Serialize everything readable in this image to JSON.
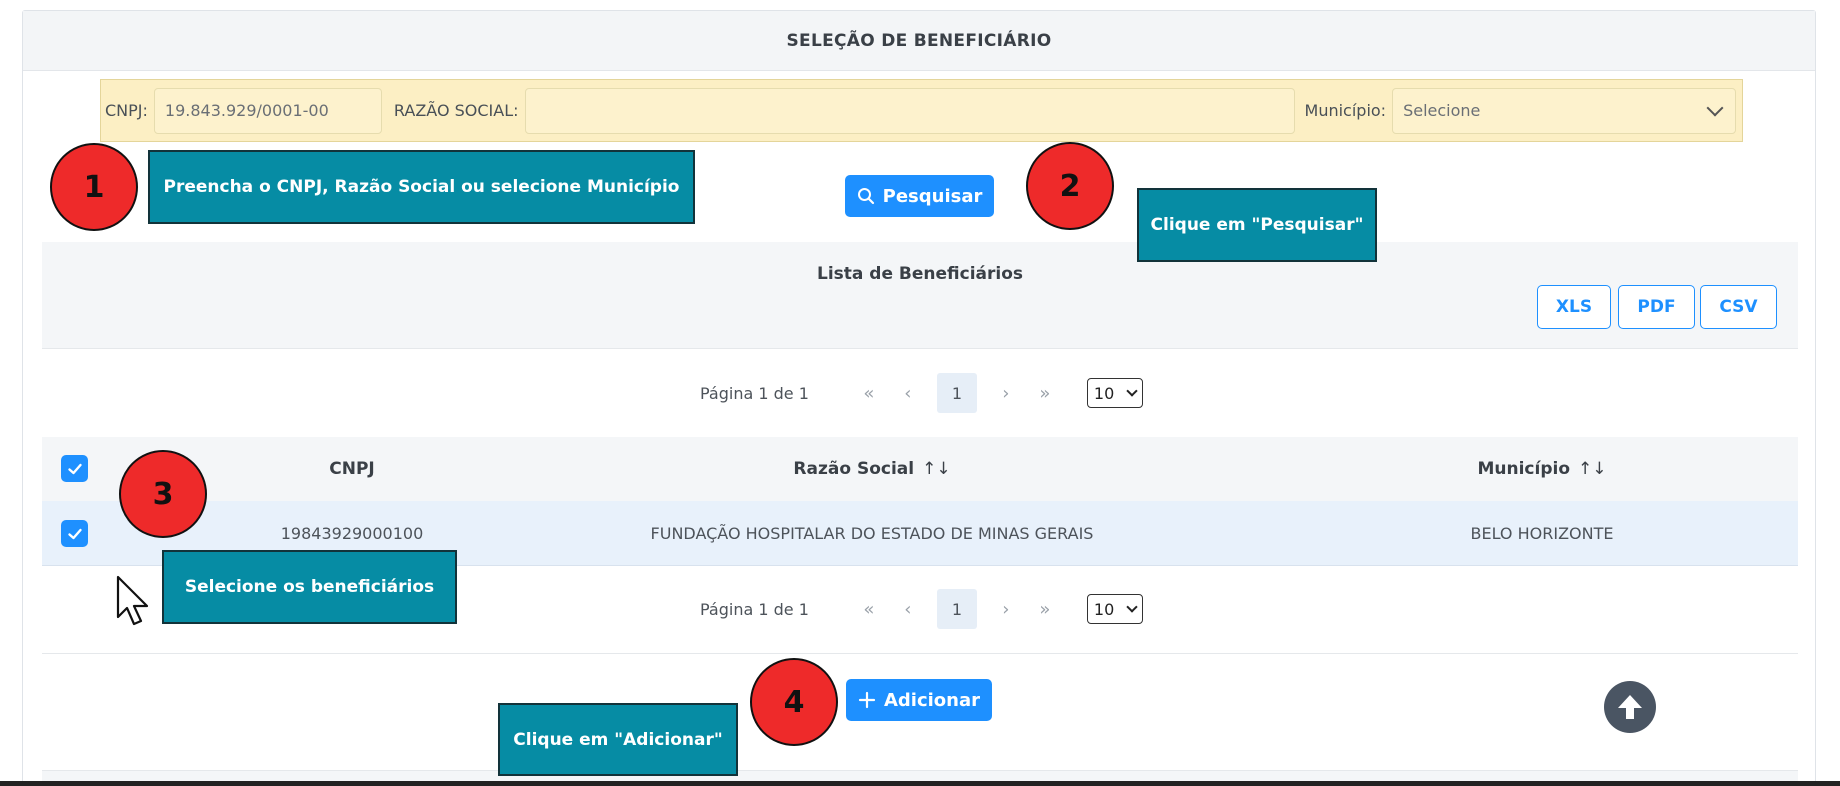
{
  "panel": {
    "title": "SELEÇÃO DE BENEFICIÁRIO"
  },
  "filters": {
    "cnpj_label": "CNPJ:",
    "cnpj_value": "19.843.929/0001-00",
    "razao_label": "RAZÃO SOCIAL:",
    "razao_value": "",
    "municipio_label": "Município:",
    "municipio_selected": "Selecione"
  },
  "search_button": {
    "label": "Pesquisar",
    "icon": "search-icon"
  },
  "list": {
    "title": "Lista de Beneficiários",
    "export": [
      "XLS",
      "PDF",
      "CSV"
    ]
  },
  "pagination": {
    "label": "Página 1 de 1",
    "first": "«",
    "prev": "‹",
    "current": "1",
    "next": "›",
    "last": "»",
    "page_size": "10"
  },
  "table": {
    "columns": {
      "cnpj": "CNPJ",
      "razao": "Razão Social",
      "municipio": "Município",
      "sort_icon": "↑↓"
    },
    "header_checked": true,
    "rows": [
      {
        "checked": true,
        "cnpj": "19843929000100",
        "razao": "FUNDAÇÃO HOSPITALAR DO ESTADO DE MINAS GERAIS",
        "municipio": "BELO HORIZONTE"
      }
    ]
  },
  "add_button": {
    "label": "Adicionar",
    "icon": "plus-icon"
  },
  "callouts": {
    "step1": {
      "number": "1",
      "text": "Preencha o CNPJ, Razão Social ou selecione Município"
    },
    "step2": {
      "number": "2",
      "text": "Clique em \"Pesquisar\""
    },
    "step3": {
      "number": "3",
      "text": "Selecione  os beneficiários"
    },
    "step4": {
      "number": "4",
      "text": "Clique em \"Adicionar\""
    }
  },
  "colors": {
    "primary": "#1e90ff",
    "callout_bg": "#068ca4",
    "step_circle": "#ee2a2a",
    "filter_bg": "#fcefc4",
    "row_selected": "#e8f1fb"
  }
}
